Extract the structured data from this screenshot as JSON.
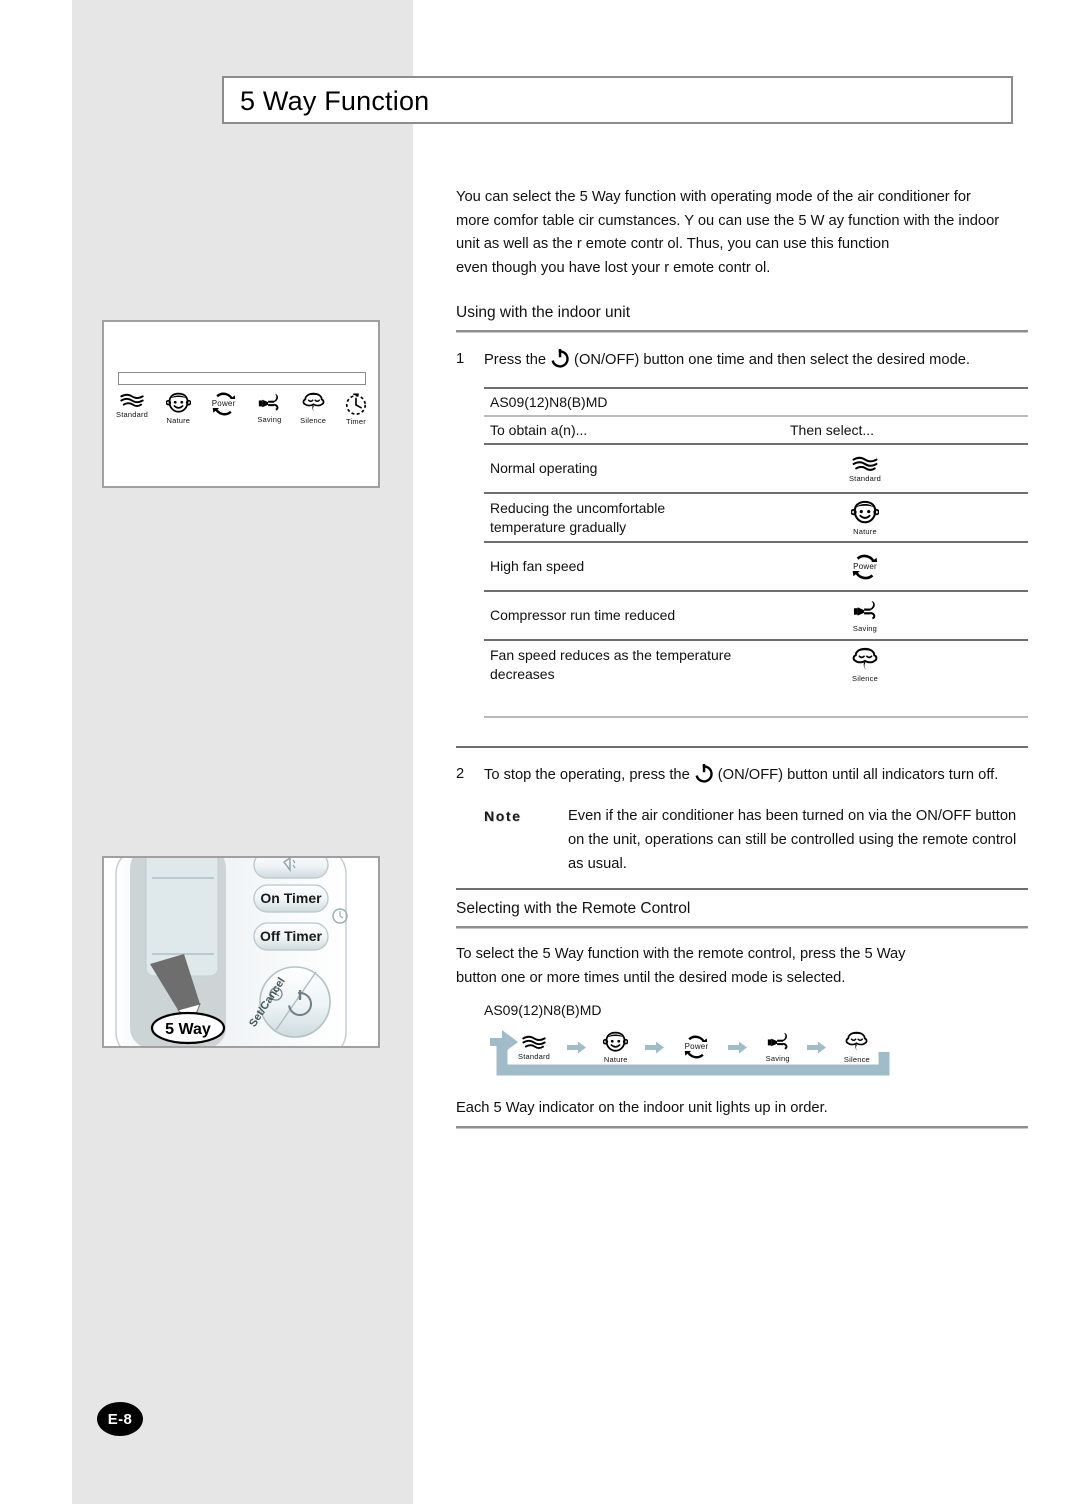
{
  "page": {
    "title": "5 Way Function",
    "page_number": "E-8"
  },
  "intro": {
    "paragraph": "You can select the 5 Way function with operating mode of the air conditioner for\nmore comfor table cir cumstances. Y ou can use the 5 W ay function with the indoor\nunit as well as the r  emote contr ol. Thus, you can use this function\neven though you have lost your r   emote contr ol."
  },
  "section_indoor": {
    "heading": "Using with the indoor unit",
    "step1": {
      "number": "1",
      "text_before": "Press the",
      "icon": "power-icon",
      "text_after": "(ON/OFF) button one time and then select the desired mode."
    },
    "table": {
      "model": "AS09(12)N8(B)MD",
      "col1_header": "To obtain a(n)...",
      "col2_header": "Then select...",
      "rows": [
        {
          "condition": "Normal operating",
          "icon": "standard-icon",
          "icon_label": "Standard"
        },
        {
          "condition": "Reducing the uncomfortable\ntemperature gradually",
          "icon": "nature-icon",
          "icon_label": "Nature"
        },
        {
          "condition": "High fan speed",
          "icon": "power-fan-icon",
          "icon_label": "Power"
        },
        {
          "condition": "Compressor run time reduced",
          "icon": "saving-icon",
          "icon_label": "Saving"
        },
        {
          "condition": "Fan speed reduces as the temperature\ndecreases",
          "icon": "silence-icon",
          "icon_label": "Silence"
        }
      ]
    },
    "step2": {
      "number": "2",
      "text_before": "To stop the operating, press the",
      "icon": "power-icon",
      "text_after": "(ON/OFF) button until all indicators turn off."
    },
    "note": {
      "label": "Note",
      "body": "Even if the air conditioner has been turned on via the ON/OFF button on the unit, operations can still be controlled using the remote control as usual."
    }
  },
  "section_remote": {
    "heading": "Selecting with the Remote Control",
    "paragraph": "To select the 5 Way function with the remote control, press the 5 Way\nbutton one or more times until the desired mode is selected.",
    "model": "AS09(12)N8(B)MD",
    "cycle": [
      {
        "icon": "standard-icon",
        "label": "Standard"
      },
      {
        "icon": "nature-icon",
        "label": "Nature"
      },
      {
        "icon": "power-fan-icon",
        "label": "Power"
      },
      {
        "icon": "saving-icon",
        "label": "Saving"
      },
      {
        "icon": "silence-icon",
        "label": "Silence"
      }
    ],
    "footer_text": "Each 5 Way indicator on the indoor unit lights up in order."
  },
  "figures": {
    "indoor_unit": {
      "indicators": [
        {
          "icon": "standard-icon",
          "label": "Standard"
        },
        {
          "icon": "nature-icon",
          "label": "Nature"
        },
        {
          "icon": "power-fan-icon",
          "label": "Power"
        },
        {
          "icon": "saving-icon",
          "label": "Saving"
        },
        {
          "icon": "silence-icon",
          "label": "Silence"
        },
        {
          "icon": "timer-icon",
          "label": "Timer"
        }
      ]
    },
    "remote_control": {
      "buttons": [
        {
          "label": "On Timer"
        },
        {
          "label": "Off Timer"
        },
        {
          "label": "Set/Cancel"
        },
        {
          "label": "5 Way"
        }
      ]
    }
  },
  "colors": {
    "band_gray": "#e6e6e6",
    "cycle_blue": "#9fbcc8",
    "rule_gray": "#8e8e8e"
  }
}
